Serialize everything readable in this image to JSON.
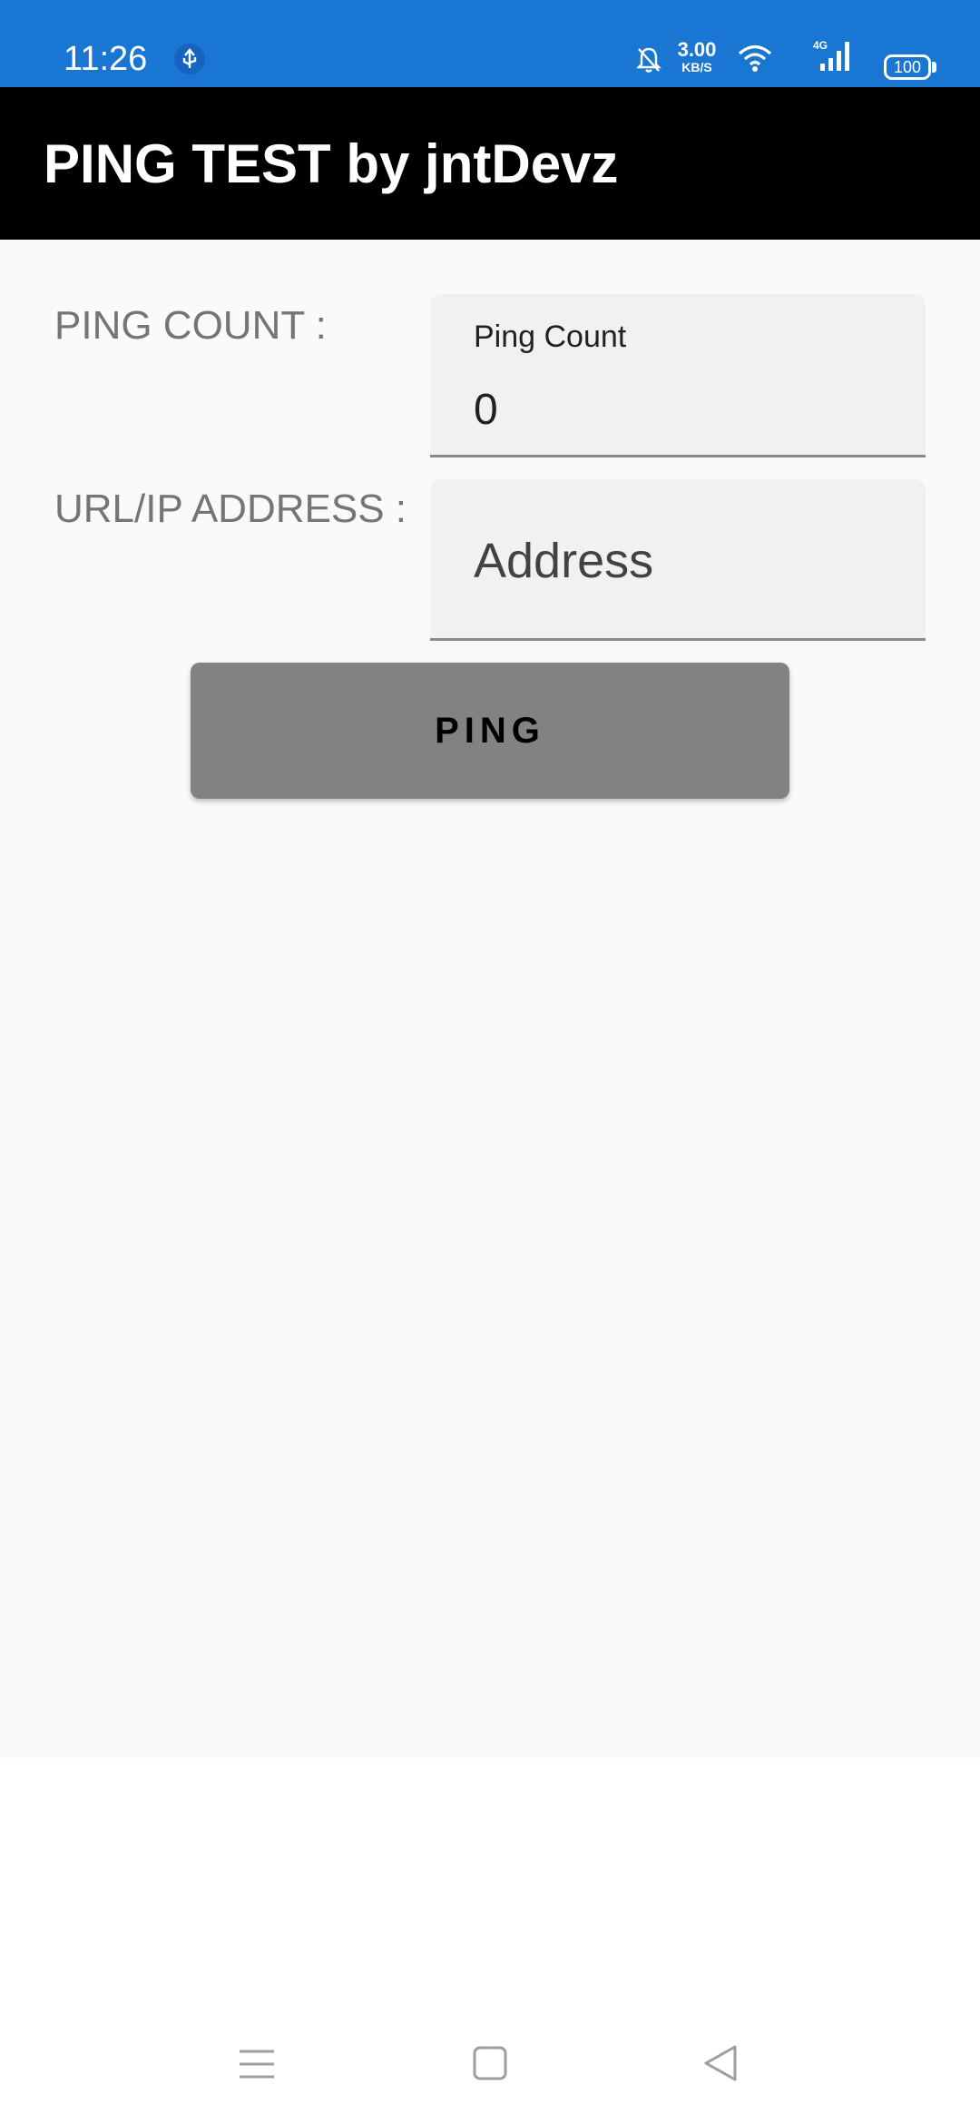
{
  "status_bar": {
    "time": "11:26",
    "net_speed_value": "3.00",
    "net_speed_unit": "KB/S",
    "network_type": "4G",
    "battery_level": "100",
    "background_color": "#1976d2"
  },
  "app_bar": {
    "title": "PING TEST by jntDevz",
    "background_color": "#000000"
  },
  "form": {
    "ping_count_label": "PING COUNT :",
    "ping_count_field_label": "Ping Count",
    "ping_count_value": "0",
    "address_label": "URL/IP ADDRESS :",
    "address_placeholder": "Address",
    "ping_button_label": "PING"
  },
  "icons": {
    "status": [
      "usb-icon",
      "bell-off-icon",
      "wifi-icon",
      "signal-icon",
      "battery-icon"
    ],
    "navigation": [
      "menu-icon",
      "home-icon",
      "back-icon"
    ]
  }
}
